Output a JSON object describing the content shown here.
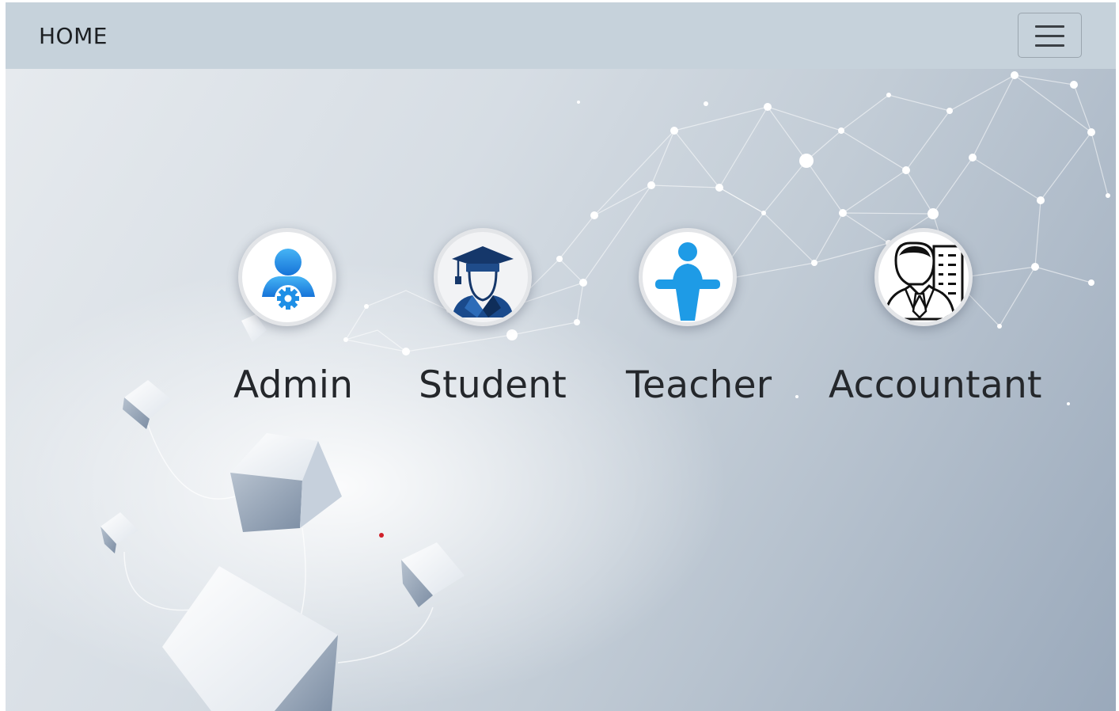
{
  "navbar": {
    "brand": "HOME",
    "toggler_icon": "hamburger-menu-icon"
  },
  "roles": [
    {
      "label": "Admin",
      "icon": "admin-user-gear-icon"
    },
    {
      "label": "Student",
      "icon": "graduate-student-icon"
    },
    {
      "label": "Teacher",
      "icon": "teacher-podium-icon"
    },
    {
      "label": "Accountant",
      "icon": "accountant-office-icon"
    }
  ],
  "colors": {
    "navbar_bg": "#c6d2db",
    "accent_blue": "#1e9be6",
    "student_navy": "#15376a",
    "text_dark": "#24272b"
  }
}
